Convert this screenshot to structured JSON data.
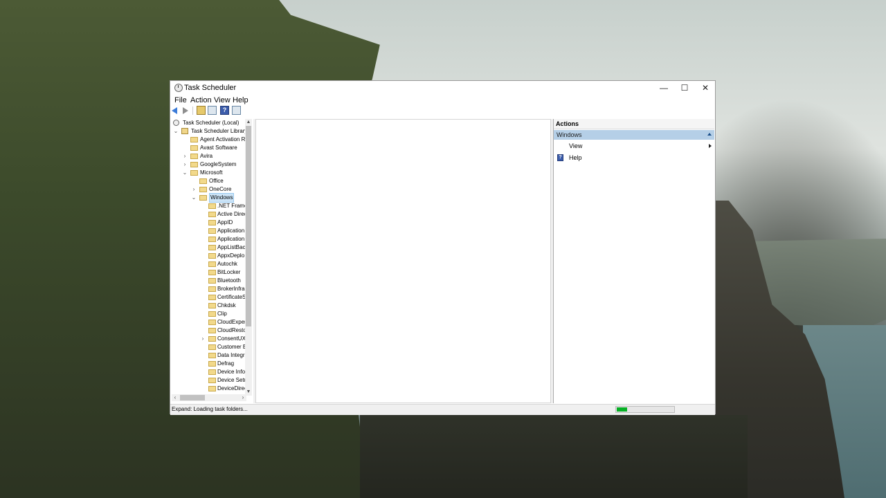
{
  "window": {
    "title": "Task Scheduler",
    "controls": {
      "minimize": "—",
      "maximize": "☐",
      "close": "✕"
    }
  },
  "menu": [
    "File",
    "Action",
    "View",
    "Help"
  ],
  "toolbar": [
    "back-icon",
    "forward-icon",
    "up-folder-icon",
    "show-hide-console-tree-icon",
    "help-icon",
    "show-hide-action-pane-icon"
  ],
  "tree": {
    "root": "Task Scheduler (Local)",
    "library": "Task Scheduler Library",
    "items": [
      "Agent Activation R",
      "Avast Software",
      "Avira",
      "GoogleSystem",
      "Microsoft",
      "Office",
      "OneCore",
      "Windows",
      ".NET Frame",
      "Active Direc",
      "AppID",
      "Application",
      "Application",
      "AppListBac",
      "AppxDeplo",
      "Autochk",
      "BitLocker",
      "Bluetooth",
      "BrokerInfra",
      "CertificateS",
      "Chkdsk",
      "Clip",
      "CloudExper",
      "CloudResto",
      "ConsentUX",
      "Customer E",
      "Data Integri",
      "Defrag",
      "Device Info",
      "Device Setu",
      "DeviceDirec"
    ]
  },
  "actions": {
    "header": "Actions",
    "section": "Windows",
    "items": [
      "View",
      "Help"
    ]
  },
  "status": {
    "text": "Expand:  Loading task folders...",
    "progress": 0.18,
    "progress_color": "#06b025"
  }
}
